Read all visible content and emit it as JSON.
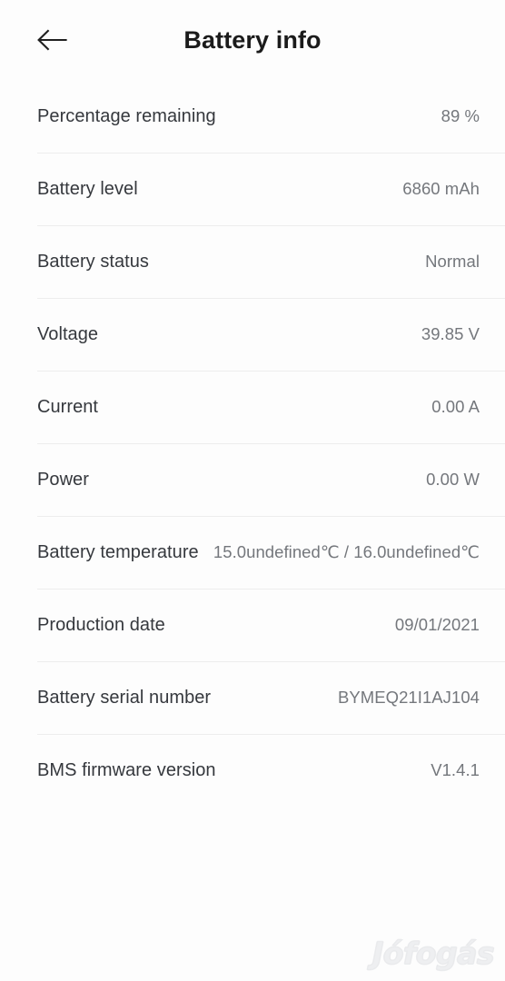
{
  "header": {
    "title": "Battery info",
    "back_icon": "arrow-left-icon"
  },
  "battery_info": {
    "rows": [
      {
        "label": "Percentage remaining",
        "value": "89 %"
      },
      {
        "label": "Battery level",
        "value": "6860 mAh"
      },
      {
        "label": "Battery status",
        "value": "Normal"
      },
      {
        "label": "Voltage",
        "value": "39.85 V"
      },
      {
        "label": "Current",
        "value": "0.00 A"
      },
      {
        "label": "Power",
        "value": "0.00 W"
      },
      {
        "label": "Battery temperature",
        "value": "15.0undefined℃ / 16.0undefined℃"
      },
      {
        "label": "Production date",
        "value": "09/01/2021"
      },
      {
        "label": "Battery serial number",
        "value": "BYMEQ21I1AJ104"
      },
      {
        "label": "BMS firmware version",
        "value": "V1.4.1"
      }
    ]
  },
  "watermark": {
    "text": "Jófogás"
  },
  "colors": {
    "background": "#fdfdfd",
    "label_text": "#35383d",
    "value_text": "#74777c",
    "divider": "#ededed",
    "title_text": "#1b1b1b",
    "watermark": "#eeeff1"
  }
}
